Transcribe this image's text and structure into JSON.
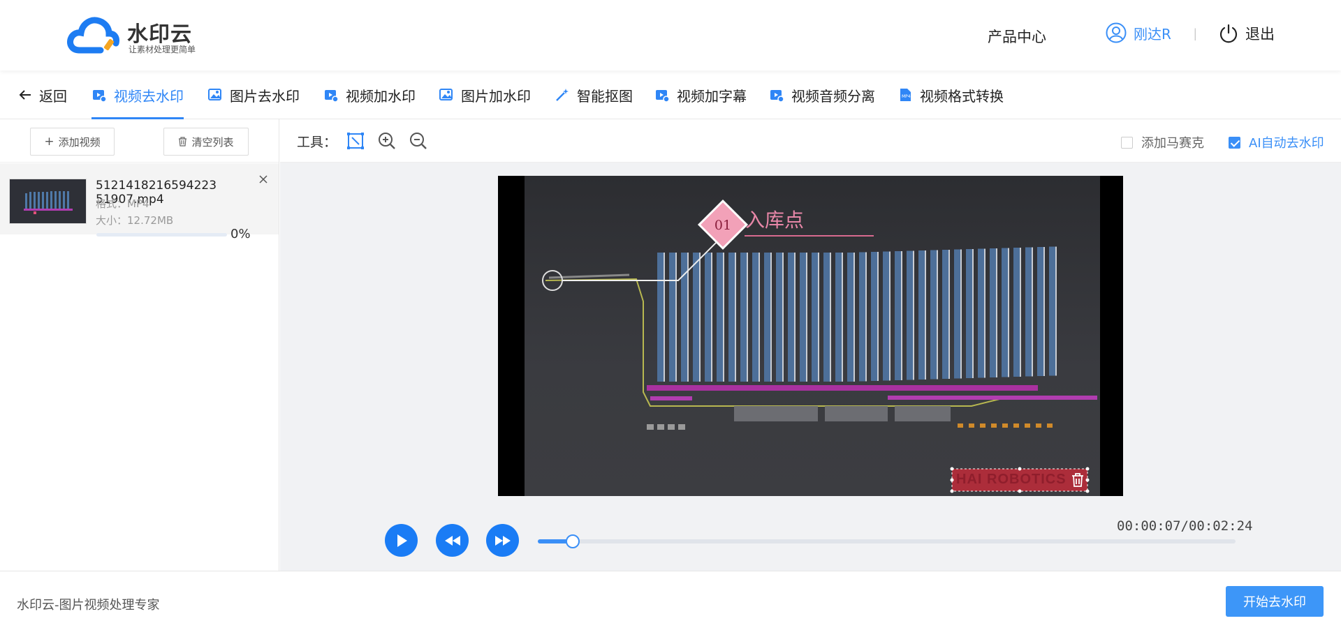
{
  "header": {
    "logo_title": "水印云",
    "logo_subtitle": "让素材处理更简单",
    "product_center": "产品中心",
    "username": "刚达R",
    "separator": "|",
    "logout": "退出",
    "icons": {
      "logo": "cloud-logo-icon",
      "user": "user-icon",
      "logout": "power-icon"
    }
  },
  "nav": {
    "back": "返回",
    "tabs": [
      {
        "label": "视频去水印",
        "icon": "video-icon",
        "active": true
      },
      {
        "label": "图片去水印",
        "icon": "image-icon",
        "active": false
      },
      {
        "label": "视频加水印",
        "icon": "video-icon",
        "active": false
      },
      {
        "label": "图片加水印",
        "icon": "image-icon",
        "active": false
      },
      {
        "label": "智能抠图",
        "icon": "magic-wand-icon",
        "active": false
      },
      {
        "label": "视频加字幕",
        "icon": "video-icon",
        "active": false
      },
      {
        "label": "视频音频分离",
        "icon": "video-icon",
        "active": false
      },
      {
        "label": "视频格式转换",
        "icon": "mp4-file-icon",
        "active": false
      }
    ]
  },
  "left": {
    "add_video": "添加视频",
    "clear_list": "清空列表",
    "file": {
      "name": "5121418216594223​51907.mp4",
      "format": "格式：MP4",
      "size": "大小：12.72MB",
      "progress_text": "0%",
      "progress": 0
    }
  },
  "tools": {
    "label": "工具：",
    "icons": [
      "select-area-icon",
      "zoom-in-icon",
      "zoom-out-icon"
    ],
    "add_mosaic": "添加马赛克",
    "add_mosaic_checked": false,
    "ai_auto": "AI自动去水印",
    "ai_auto_checked": true
  },
  "video": {
    "callout_number": "01",
    "callout_label": "入库点",
    "watermark_text": "HAI ROBOTICS"
  },
  "player": {
    "time": "00:00:07/00:02:24",
    "progress_fraction": 0.05
  },
  "footer": {
    "brand_text": "水印云-图片视频处理专家",
    "start_button": "开始去水印"
  },
  "colors": {
    "accent": "#2f86f6",
    "button": "#3d96f8"
  }
}
